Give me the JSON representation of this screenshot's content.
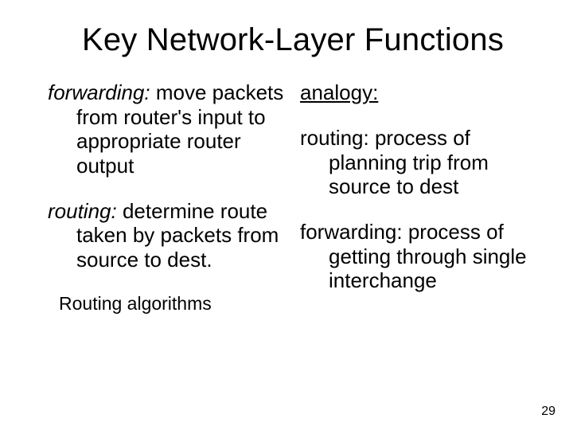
{
  "title": "Key Network-Layer Functions",
  "left": {
    "forwarding_term": "forwarding:",
    "forwarding_body": " move packets from router's input to appropriate router output",
    "routing_term": "routing:",
    "routing_body": " determine route taken by packets from source to dest.",
    "sub": "Routing algorithms"
  },
  "right": {
    "analogy": "analogy:",
    "routing_term": "routing:",
    "routing_body": " process of planning trip from source to dest",
    "forwarding_term": "forwarding:",
    "forwarding_body": " process of getting through single interchange"
  },
  "page_number": "29"
}
